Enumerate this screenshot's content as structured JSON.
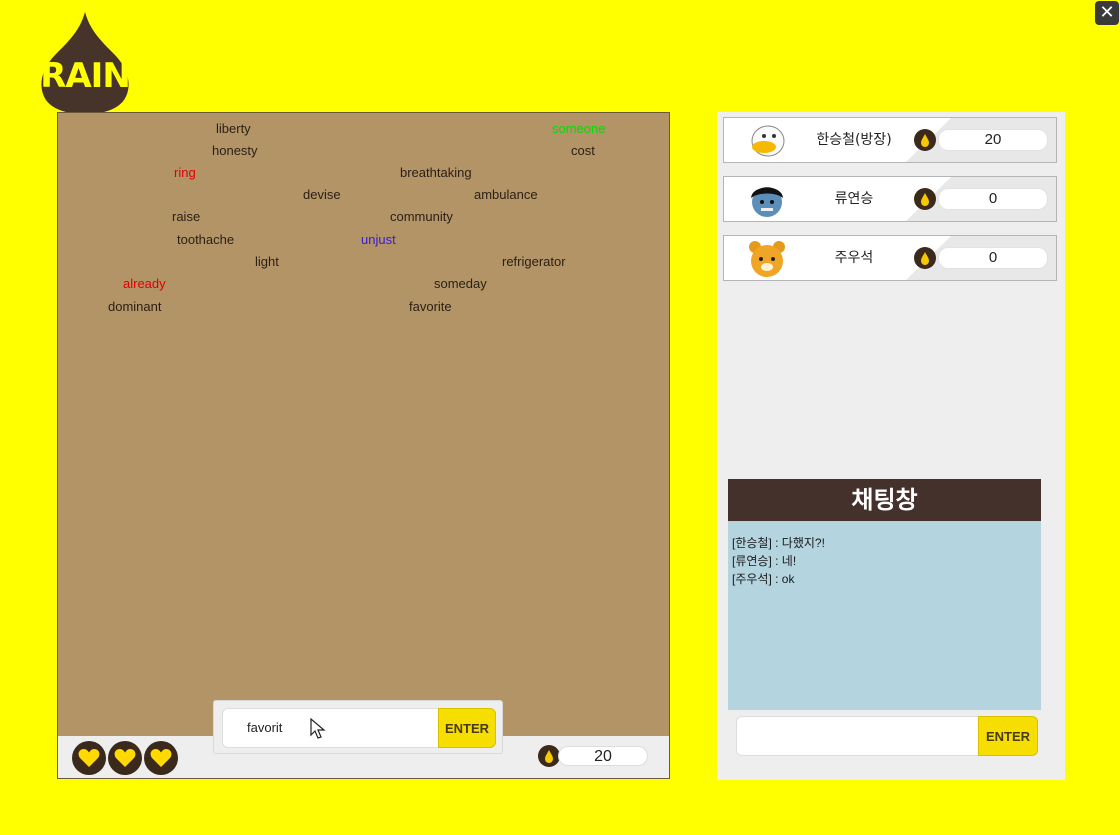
{
  "window": {
    "close_icon": "close-icon"
  },
  "logo": {
    "text": "RAIN"
  },
  "game": {
    "words": [
      {
        "text": "liberty",
        "color": "#2a1f14"
      },
      {
        "text": "someone",
        "color": "#00dd00"
      },
      {
        "text": "honesty",
        "color": "#2a1f14"
      },
      {
        "text": "cost",
        "color": "#2a1f14"
      },
      {
        "text": "ring",
        "color": "#dd0000"
      },
      {
        "text": "breathtaking",
        "color": "#2a1f14"
      },
      {
        "text": "devise",
        "color": "#2a1f14"
      },
      {
        "text": "ambulance",
        "color": "#2a1f14"
      },
      {
        "text": "raise",
        "color": "#2a1f14"
      },
      {
        "text": "community",
        "color": "#2a1f14"
      },
      {
        "text": "toothache",
        "color": "#2a1f14"
      },
      {
        "text": "unjust",
        "color": "#3a1ad8"
      },
      {
        "text": "light",
        "color": "#2a1f14"
      },
      {
        "text": "refrigerator",
        "color": "#2a1f14"
      },
      {
        "text": "already",
        "color": "#dd0000"
      },
      {
        "text": "someday",
        "color": "#2a1f14"
      },
      {
        "text": "dominant",
        "color": "#2a1f14"
      },
      {
        "text": "favorite",
        "color": "#2a1f14"
      }
    ],
    "lives": 3,
    "score": "20",
    "input_value": "favorit",
    "enter_label": "ENTER"
  },
  "players": [
    {
      "name": "한승철(방장)",
      "score": "20",
      "avatar": "duck-avatar"
    },
    {
      "name": "류연승",
      "score": "0",
      "avatar": "kid-avatar"
    },
    {
      "name": "주우석",
      "score": "0",
      "avatar": "bear-avatar"
    }
  ],
  "chat": {
    "title": "채팅창",
    "messages": [
      "[한승철] : 다했지?!",
      "[류연승] : 네!",
      "[주우석] : ok"
    ],
    "enter_label": "ENTER"
  },
  "colors": {
    "background": "#ffff00",
    "game_panel": "#b39467",
    "chat_header": "#45312c",
    "chat_body": "#b4d4e0",
    "button": "#f5de00"
  }
}
